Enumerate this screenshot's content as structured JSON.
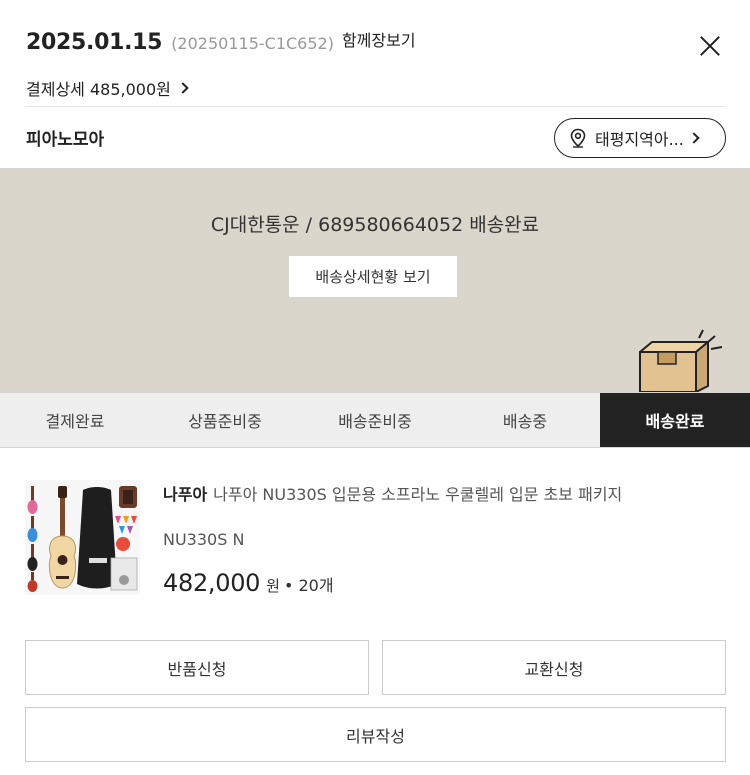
{
  "order": {
    "date": "2025.01.15",
    "order_id": "(20250115-C1C652)",
    "together_label": "함께장보기",
    "payment_label": "결제상세 485,000원"
  },
  "store": {
    "name": "피아노모아",
    "region_label": "태평지역아..."
  },
  "delivery": {
    "status_text": "CJ대한통운 / 689580664052 배송완료",
    "detail_button": "배송상세현황 보기"
  },
  "steps": [
    {
      "label": "결제완료",
      "active": false
    },
    {
      "label": "상품준비중",
      "active": false
    },
    {
      "label": "배송준비중",
      "active": false
    },
    {
      "label": "배송중",
      "active": false
    },
    {
      "label": "배송완료",
      "active": true
    }
  ],
  "product": {
    "brand": "나푸아",
    "title": "나푸아 NU330S 입문용 소프라노 우쿨렐레 입문 초보 패키지",
    "option": "NU330S N",
    "price": "482,000",
    "currency": "원",
    "quantity": "• 20개"
  },
  "actions": {
    "return_label": "반품신청",
    "exchange_label": "교환신청",
    "review_label": "리뷰작성"
  },
  "colors": {
    "panel_bg": "#dbd6cc",
    "active_step_bg": "#222222",
    "box_color": "#e2c290"
  },
  "icons": {
    "close": "close-icon",
    "location": "location-pin-icon",
    "box": "delivery-box-icon"
  }
}
